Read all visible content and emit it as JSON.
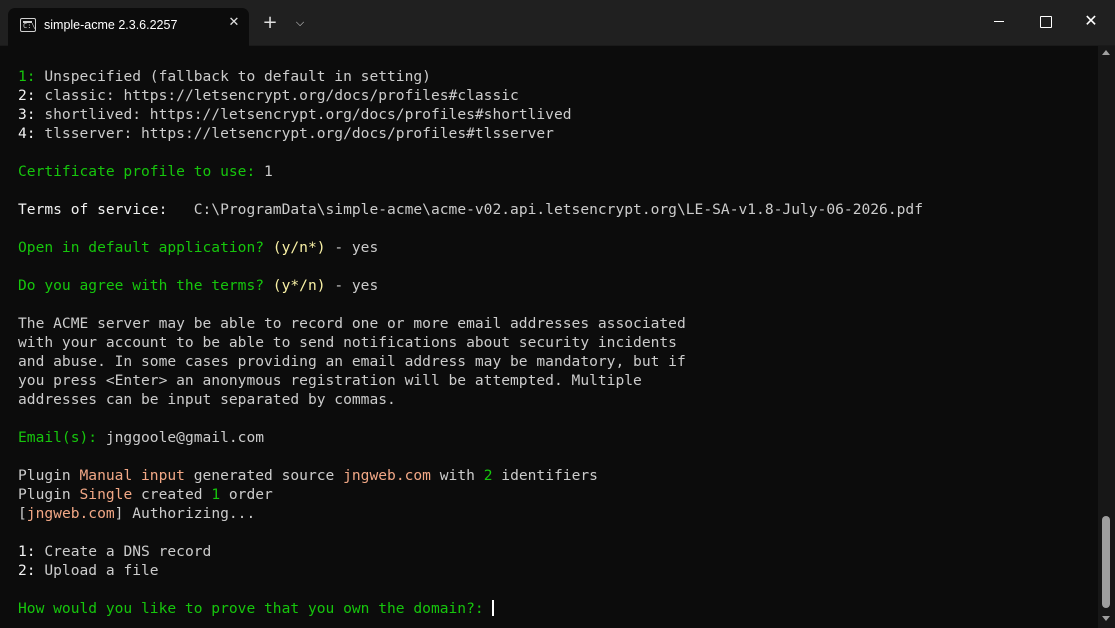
{
  "window": {
    "tab_title": "simple-acme 2.3.6.2257",
    "tab_icon": "terminal-icon",
    "close_tab_glyph": "✕",
    "new_tab_glyph": "+",
    "dropdown_glyph": "⌵",
    "close_window_glyph": "✕"
  },
  "terminal": {
    "profiles": [
      {
        "num": "1:",
        "text": " Unspecified (fallback to default in setting)"
      },
      {
        "num": "2:",
        "text": " classic: https://letsencrypt.org/docs/profiles#classic"
      },
      {
        "num": "3:",
        "text": " shortlived: https://letsencrypt.org/docs/profiles#shortlived"
      },
      {
        "num": "4:",
        "text": " tlsserver: https://letsencrypt.org/docs/profiles#tlsserver"
      }
    ],
    "profile_prompt": "Certificate profile to use:",
    "profile_answer": " 1",
    "tos_label": "Terms of service:",
    "tos_path": "   C:\\ProgramData\\simple-acme\\acme-v02.api.letsencrypt.org\\LE-SA-v1.8-July-06-2026.pdf",
    "open_prompt": "Open in default application?",
    "open_options": " (y/n*)",
    "open_answer": " - yes",
    "agree_prompt": "Do you agree with the terms?",
    "agree_options": " (y*/n)",
    "agree_answer": " - yes",
    "email_info": [
      "The ACME server may be able to record one or more email addresses associated",
      "with your account to be able to send notifications about security incidents",
      "and abuse. In some cases providing an email address may be mandatory, but if",
      "you press <Enter> an anonymous registration will be attempted. Multiple",
      "addresses can be input separated by commas."
    ],
    "email_prompt": "Email(s):",
    "email_answer": " jnggoole@gmail.com",
    "plugin_line1": {
      "prefix": "Plugin ",
      "plugin": "Manual input",
      "middle": " generated source ",
      "domain": "jngweb.com",
      "with": " with ",
      "count": "2",
      "suffix": " identifiers"
    },
    "plugin_line2": {
      "prefix": "Plugin ",
      "plugin": "Single",
      "middle": " created ",
      "count": "1",
      "suffix": " order"
    },
    "auth_line": {
      "open": "[",
      "domain": "jngweb.com",
      "close": "] Authorizing..."
    },
    "validation_options": [
      {
        "num": "1:",
        "text": " Create a DNS record"
      },
      {
        "num": "2:",
        "text": " Upload a file"
      }
    ],
    "final_prompt": "How would you like to prove that you own the domain?:",
    "final_input": " "
  },
  "colors": {
    "background": "#0c0c0c",
    "prompt_green": "#16c60c",
    "highlight_yellow": "#f9f1a5",
    "highlight_orange": "#f2a886",
    "text": "#cccccc"
  }
}
